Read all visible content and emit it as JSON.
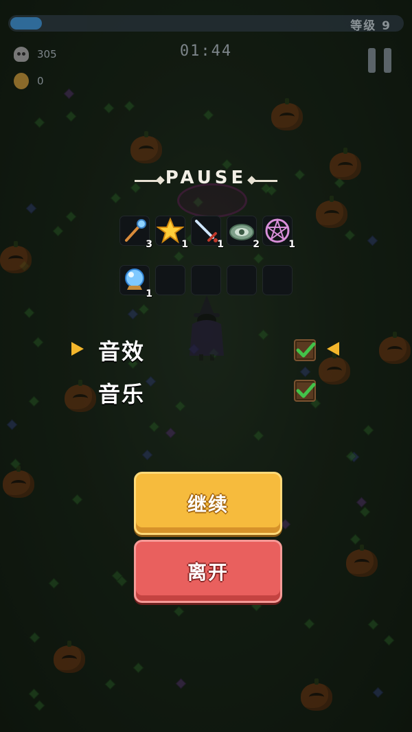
{
  "hud": {
    "level_text": "等级 9",
    "xp_fraction": 0.08,
    "kills": "305",
    "coins": "0",
    "timer": "01:44"
  },
  "pause": {
    "title": "PAUSE",
    "weapons": [
      {
        "icon": "staff-icon",
        "level": "3"
      },
      {
        "icon": "star-icon",
        "level": "1"
      },
      {
        "icon": "dagger-icon",
        "level": "1"
      },
      {
        "icon": "eye-icon",
        "level": "2"
      },
      {
        "icon": "pentagram-icon",
        "level": "1"
      }
    ],
    "passives": [
      {
        "icon": "crystal-ball-icon",
        "level": "1"
      }
    ],
    "options": [
      {
        "label": "音效",
        "checked": true,
        "selected": true
      },
      {
        "label": "音乐",
        "checked": true,
        "selected": false
      }
    ],
    "continue_label": "继续",
    "leave_label": "离开"
  },
  "colors": {
    "continue": "#f6bb3d",
    "leave": "#e9605e",
    "selector": "#f3b62c",
    "check": "#42c24a"
  }
}
